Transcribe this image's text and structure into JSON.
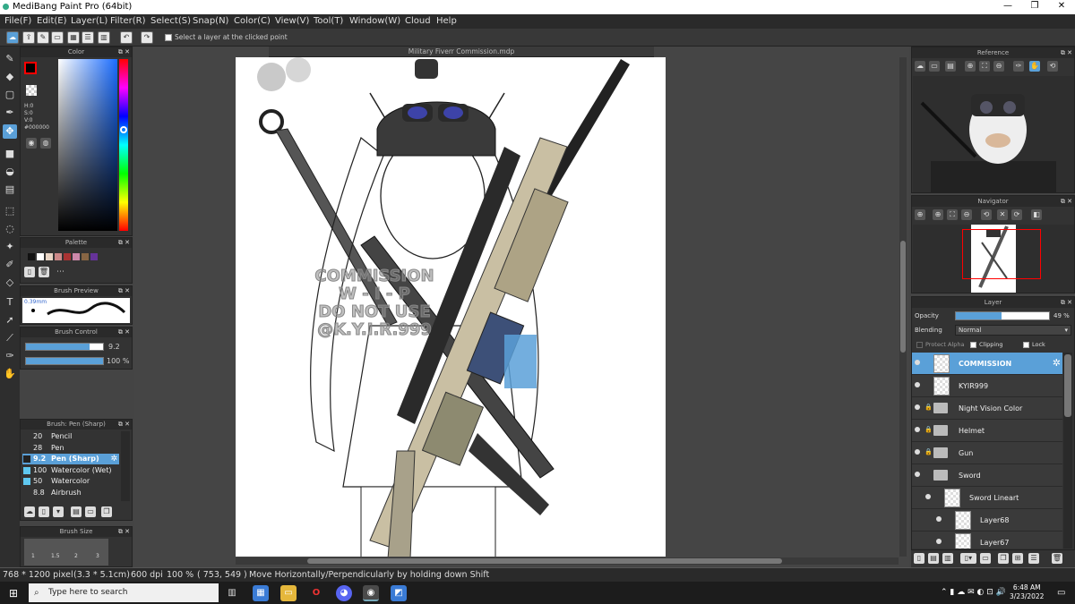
{
  "window": {
    "title": "MediBang Paint Pro (64bit)",
    "minimize": "—",
    "restore": "❐",
    "close": "✕"
  },
  "menu": [
    "File(F)",
    "Edit(E)",
    "Layer(L)",
    "Filter(R)",
    "Select(S)",
    "Snap(N)",
    "Color(C)",
    "View(V)",
    "Tool(T)",
    "Window(W)",
    "Cloud",
    "Help"
  ],
  "toolbar": {
    "select_layer_hint": "Select a layer at the clicked point"
  },
  "document": {
    "tab_title": "Military Fiverr Commission.mdp"
  },
  "color_panel": {
    "title": "Color",
    "h": "H:0",
    "s": "S:0",
    "v": "V:0",
    "hex": "#000000"
  },
  "palette_panel": {
    "title": "Palette",
    "more": "⋯"
  },
  "brush_preview": {
    "title": "Brush Preview",
    "size": "0.39mm"
  },
  "brush_control": {
    "title": "Brush Control",
    "size_value": "9.2",
    "opacity_value": "100 %",
    "size_fraction": 0.82,
    "opacity_fraction": 1.0
  },
  "brush_list": {
    "title": "Brush: Pen (Sharp)",
    "items": [
      {
        "size": "20",
        "name": "Pencil",
        "swatch": "#333333"
      },
      {
        "size": "28",
        "name": "Pen",
        "swatch": "#333333"
      },
      {
        "size": "9.2",
        "name": "Pen (Sharp)",
        "swatch": "#222222"
      },
      {
        "size": "100",
        "name": "Watercolor (Wet)",
        "swatch": "#5fc8f0"
      },
      {
        "size": "50",
        "name": "Watercolor",
        "swatch": "#5fc8f0"
      },
      {
        "size": "8.8",
        "name": "Airbrush",
        "swatch": "#333333"
      }
    ],
    "selected_index": 2
  },
  "brush_size": {
    "title": "Brush Size",
    "sizes": [
      "1",
      "1.5",
      "2",
      "3"
    ]
  },
  "reference": {
    "title": "Reference"
  },
  "navigator": {
    "title": "Navigator"
  },
  "layer_panel": {
    "title": "Layer",
    "opacity_label": "Opacity",
    "opacity_value": "49 %",
    "opacity_fraction": 0.49,
    "blending_label": "Blending",
    "blending_value": "Normal",
    "protect_alpha": "Protect Alpha",
    "clipping": "Clipping",
    "lock": "Lock",
    "layers": [
      {
        "name": "COMMISSION",
        "kind": "layer",
        "selected": true,
        "locked": false,
        "indent": 0
      },
      {
        "name": "KYIR999",
        "kind": "layer",
        "selected": false,
        "locked": false,
        "indent": 0
      },
      {
        "name": "Night Vision Color",
        "kind": "folder",
        "selected": false,
        "locked": true,
        "indent": 0
      },
      {
        "name": "Helmet",
        "kind": "folder",
        "selected": false,
        "locked": true,
        "indent": 0
      },
      {
        "name": "Gun",
        "kind": "folder",
        "selected": false,
        "locked": true,
        "indent": 0
      },
      {
        "name": "Sword",
        "kind": "folder",
        "selected": false,
        "locked": false,
        "indent": 0
      },
      {
        "name": "Sword Lineart",
        "kind": "layer",
        "selected": false,
        "locked": false,
        "indent": 1
      },
      {
        "name": "Layer68",
        "kind": "layer",
        "selected": false,
        "locked": false,
        "indent": 2
      },
      {
        "name": "Layer67",
        "kind": "layer",
        "selected": false,
        "locked": false,
        "indent": 2
      }
    ]
  },
  "watermark": [
    "COMMISSION",
    "W - I - P",
    "DO NOT USE",
    "@K.Y.I.R.999"
  ],
  "status": {
    "dimensions": "768 * 1200 pixel",
    "physical_size": "(3.3 * 5.1cm)",
    "dpi": "600 dpi",
    "zoom": "100 %",
    "cursor": "( 753, 549 )",
    "hint": "Move Horizontally/Perpendicularly by holding down Shift"
  },
  "taskbar": {
    "search_placeholder": "Type here to search",
    "time": "6:48 AM",
    "date": "3/23/2022"
  },
  "colors": {
    "accent": "#5aa0d8",
    "panel": "#333333",
    "canvas_bg": "#454545"
  }
}
